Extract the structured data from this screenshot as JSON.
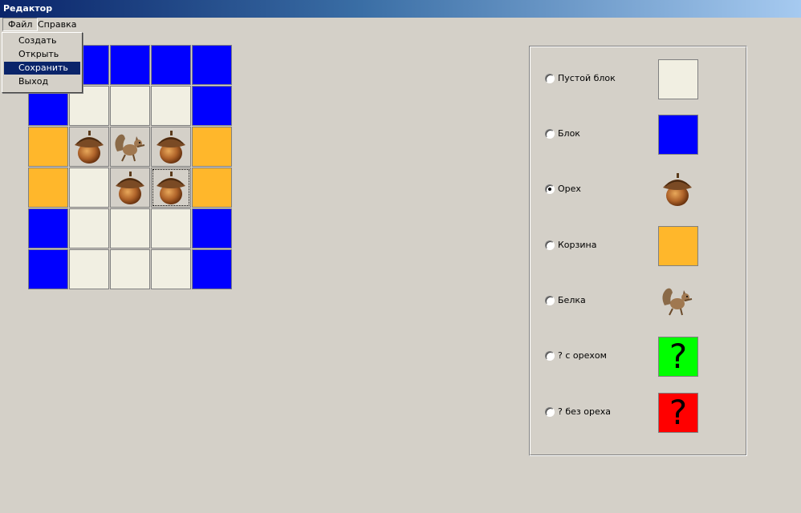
{
  "window": {
    "title": "Редактор"
  },
  "menubar": {
    "items": [
      {
        "label": "Файл"
      },
      {
        "label": "Справка"
      }
    ]
  },
  "file_menu": {
    "items": [
      {
        "label": "Создать"
      },
      {
        "label": "Открыть"
      },
      {
        "label": "Сохранить",
        "selected": true
      },
      {
        "label": "Выход"
      }
    ]
  },
  "map": {
    "rows": [
      [
        "block",
        "block",
        "block",
        "block",
        "block"
      ],
      [
        "block",
        "empty",
        "empty",
        "empty",
        "block"
      ],
      [
        "basket",
        "nut",
        "squirrel",
        "nut",
        "basket"
      ],
      [
        "basket",
        "empty",
        "nut",
        "nut",
        "basket"
      ],
      [
        "block",
        "empty",
        "empty",
        "empty",
        "block"
      ],
      [
        "block",
        "empty",
        "empty",
        "empty",
        "block"
      ]
    ]
  },
  "palette": {
    "options": [
      {
        "label": "Пустой блок",
        "type": "empty",
        "checked": false
      },
      {
        "label": "Блок",
        "type": "block",
        "checked": false
      },
      {
        "label": "Орех",
        "type": "nut",
        "checked": true
      },
      {
        "label": "Корзина",
        "type": "basket",
        "checked": false
      },
      {
        "label": "Белка",
        "type": "squirrel",
        "checked": false
      },
      {
        "label": "? с орехом",
        "type": "question-with-nut",
        "glyph": "?",
        "checked": false
      },
      {
        "label": "? без ореха",
        "type": "question-without-nut",
        "glyph": "?",
        "checked": false
      }
    ]
  },
  "colors": {
    "empty": "#f1efe2",
    "block": "#0000ff",
    "basket": "#ffb72b",
    "question-with-nut": "#00ff00",
    "question-without-nut": "#ff0000",
    "accent": "#0a246a"
  }
}
